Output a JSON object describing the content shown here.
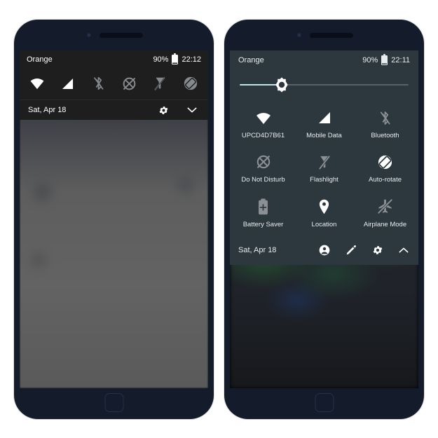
{
  "left_phone": {
    "name": "android-quick-settings-collapsed",
    "status_bar": {
      "carrier": "Orange",
      "battery_percent": "90%",
      "battery_icon": "battery-icon",
      "time": "22:12"
    },
    "quick_icons": [
      {
        "name": "wifi-icon",
        "label": "Wi-Fi",
        "state": "on"
      },
      {
        "name": "signal-icon",
        "label": "Mobile Data",
        "state": "on"
      },
      {
        "name": "bluetooth-off-icon",
        "label": "Bluetooth",
        "state": "off"
      },
      {
        "name": "do-not-disturb-off-icon",
        "label": "Do Not Disturb",
        "state": "off"
      },
      {
        "name": "flashlight-off-icon",
        "label": "Flashlight",
        "state": "off"
      },
      {
        "name": "auto-rotate-icon",
        "label": "Auto-rotate",
        "state": "off"
      }
    ],
    "date_bar": {
      "date": "Sat, Apr 18",
      "settings_icon": "gear-icon",
      "expand_icon": "chevron-down-icon"
    }
  },
  "right_phone": {
    "name": "android-quick-settings-expanded",
    "status_bar": {
      "carrier": "Orange",
      "battery_percent": "90%",
      "battery_icon": "battery-icon",
      "time": "22:11"
    },
    "brightness": {
      "name": "brightness-slider",
      "value_percent": 25,
      "thumb_icon": "brightness-sun-icon",
      "fill_color": "#bfe3e6",
      "track_color": "#55636a"
    },
    "tiles": [
      [
        {
          "icon": "wifi-icon",
          "label": "UPCD4D7B61",
          "state": "on"
        },
        {
          "icon": "signal-icon",
          "label": "Mobile Data",
          "state": "on"
        },
        {
          "icon": "bluetooth-off-icon",
          "label": "Bluetooth",
          "state": "off"
        }
      ],
      [
        {
          "icon": "do-not-disturb-off-icon",
          "label": "Do Not Disturb",
          "state": "off"
        },
        {
          "icon": "flashlight-off-icon",
          "label": "Flashlight",
          "state": "off"
        },
        {
          "icon": "auto-rotate-icon",
          "label": "Auto-rotate",
          "state": "off"
        }
      ],
      [
        {
          "icon": "battery-saver-icon",
          "label": "Battery Saver",
          "state": "off"
        },
        {
          "icon": "location-pin-icon",
          "label": "Location",
          "state": "on"
        },
        {
          "icon": "airplane-mode-off-icon",
          "label": "Airplane Mode",
          "state": "off"
        }
      ]
    ],
    "date_bar": {
      "date": "Sat, Apr 18",
      "user_icon": "user-account-icon",
      "edit_icon": "pencil-edit-icon",
      "settings_icon": "gear-icon",
      "collapse_icon": "chevron-up-icon"
    }
  },
  "colors": {
    "page_background": "#ffffff",
    "phone_body": "#141c2b",
    "left_panel_bg": "#1e1e1e",
    "right_panel_bg": "#2c373e",
    "icon_on": "#ffffff",
    "icon_off": "#8b9094",
    "accent": "#bfe3e6"
  }
}
